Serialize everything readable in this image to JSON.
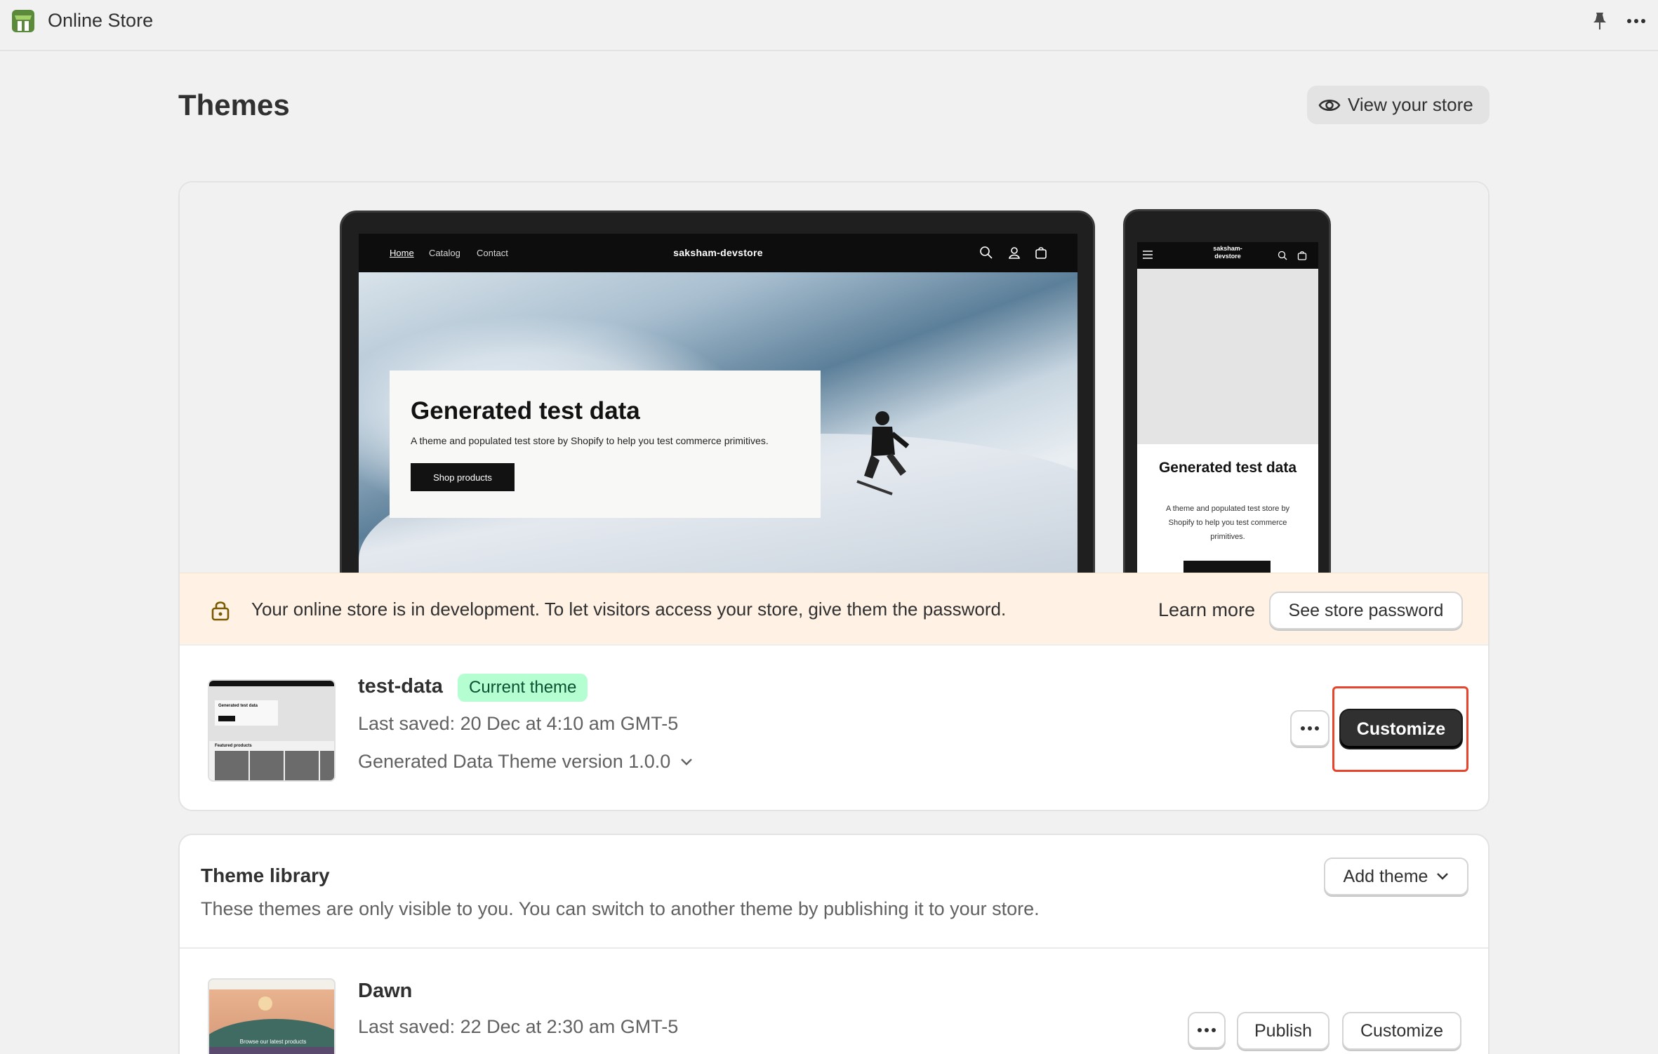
{
  "app": {
    "title": "Online Store",
    "brand_color": "#5a8a3a"
  },
  "header": {
    "title": "Themes",
    "view_store_label": "View your store"
  },
  "preview": {
    "nav": {
      "home": "Home",
      "catalog": "Catalog",
      "contact": "Contact"
    },
    "store_name": "saksham-devstore",
    "phone_store_name": "saksham-\ndevstore",
    "hero_title": "Generated test data",
    "hero_subtitle": "A theme and populated test store by Shopify to help you test commerce primitives.",
    "hero_button": "Shop products",
    "phone_title": "Generated test data",
    "phone_subtitle": "A theme and populated test store by Shopify to help you test commerce primitives."
  },
  "dev_banner": {
    "message": "Your online store is in development. To let visitors access your store, give them the password.",
    "learn_more": "Learn more",
    "password_button": "See store password",
    "background_color": "#fff1e3"
  },
  "current_theme": {
    "name": "test-data",
    "badge": "Current theme",
    "badge_color": "#b4fed2",
    "last_saved": "Last saved: 20 Dec at 4:10 am GMT-5",
    "version": "Generated Data Theme version 1.0.0",
    "customize_label": "Customize",
    "thumb_title": "Generated test data",
    "thumb_featured": "Featured products"
  },
  "library": {
    "title": "Theme library",
    "description": "These themes are only visible to you. You can switch to another theme by publishing it to your store.",
    "add_theme_label": "Add theme",
    "themes": [
      {
        "name": "Dawn",
        "last_saved": "Last saved: 22 Dec at 2:30 am GMT-5",
        "publish_label": "Publish",
        "customize_label": "Customize",
        "thumb_caption": "Browse our latest products"
      }
    ]
  },
  "highlight_color": "#e8432d"
}
